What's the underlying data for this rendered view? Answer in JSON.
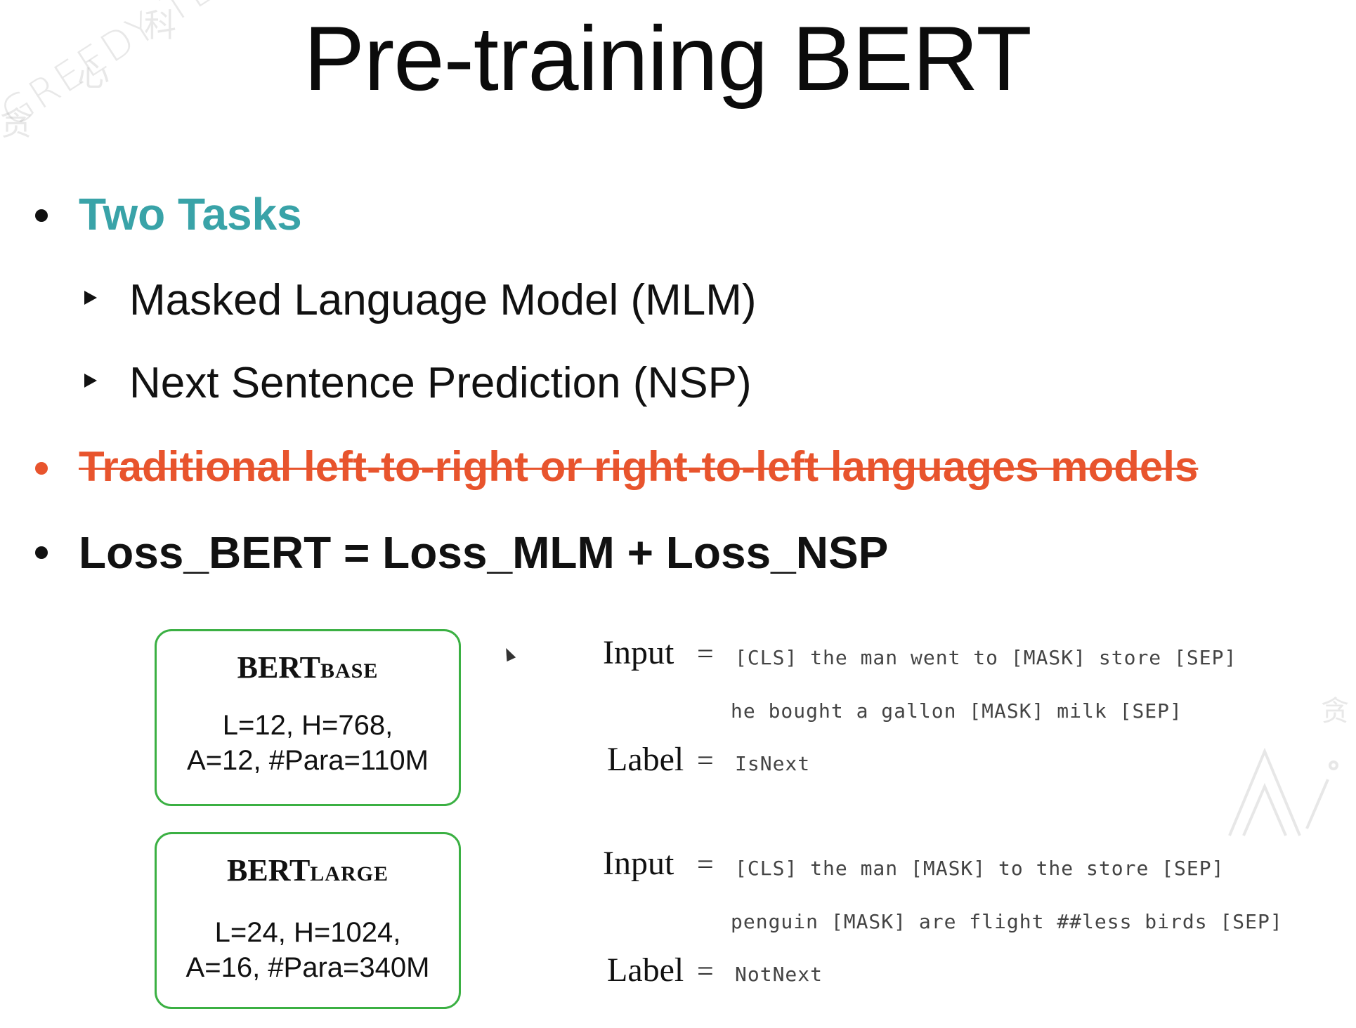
{
  "slide": {
    "title": "Pre-training BERT",
    "watermark": "GREEDY TECHNOLOGY",
    "bullets": {
      "two_tasks": "Two Tasks",
      "mlm": "Masked Language Model (MLM)",
      "nsp": "Next Sentence Prediction (NSP)",
      "traditional": "Traditional left-to-right or right-to-left languages models",
      "loss": "Loss_BERT = Loss_MLM + Loss_NSP"
    },
    "colors": {
      "accent_teal": "#39a3a8",
      "strike_orange": "#e8542d",
      "box_green": "#3bb043"
    },
    "bert_base": {
      "name": "BERT",
      "suffix": "BASE",
      "line1": "L=12, H=768,",
      "line2": "A=12, #Para=110M"
    },
    "bert_large": {
      "name": "BERT",
      "suffix": "LARGE",
      "line1": "L=24, H=1024,",
      "line2": "A=16, #Para=340M"
    },
    "example1": {
      "input_label": "Input",
      "equals": "=",
      "input_line1": "[CLS] the man went to [MASK] store [SEP]",
      "input_line2": "he bought a gallon [MASK] milk [SEP]",
      "label_label": "Label",
      "label_value": "IsNext"
    },
    "example2": {
      "input_label": "Input",
      "equals": "=",
      "input_line1": "[CLS] the man [MASK] to the store [SEP]",
      "input_line2": "penguin [MASK] are flight ##less birds [SEP]",
      "label_label": "Label",
      "label_value": "NotNext"
    }
  }
}
